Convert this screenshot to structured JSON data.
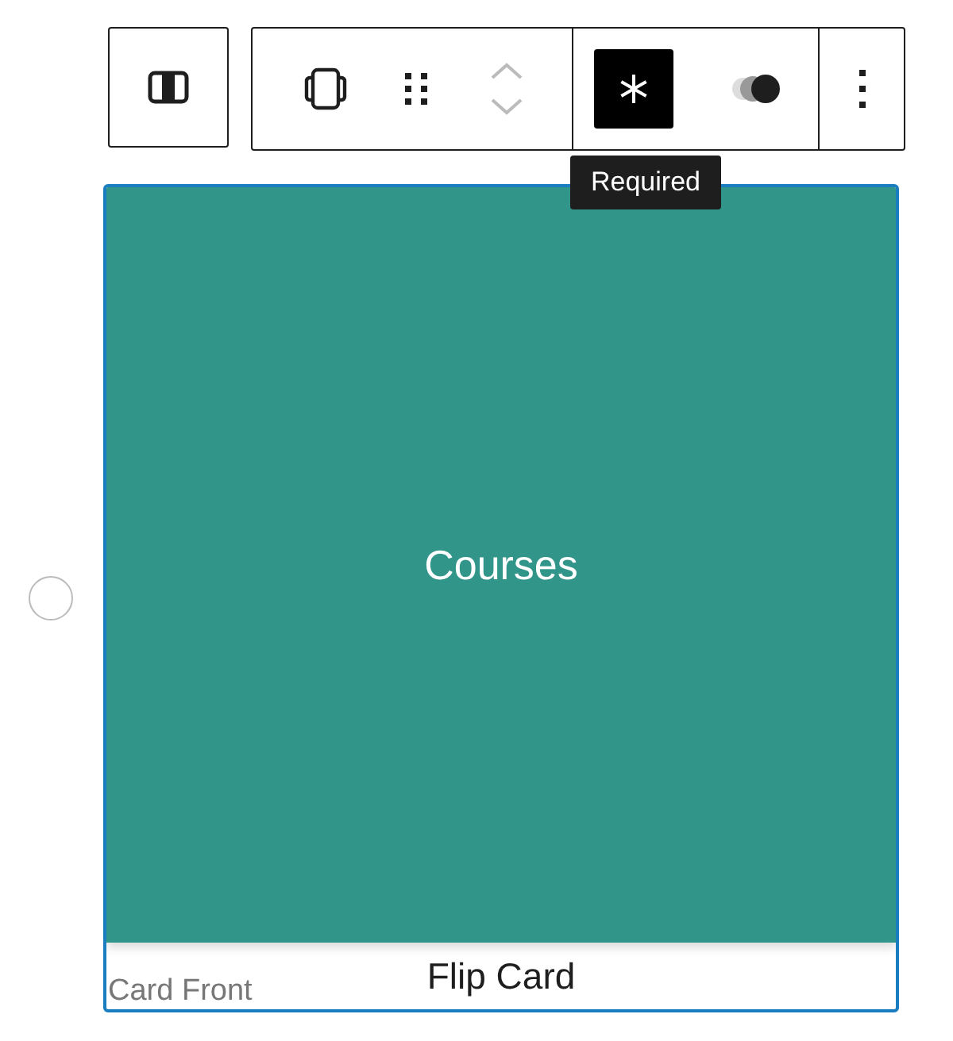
{
  "block_switcher": {
    "kind": "columns",
    "selected": false,
    "disabled": false
  },
  "toolbar_groups": [
    [
      {
        "kind": "card",
        "selected": false,
        "disabled": false
      },
      {
        "kind": "drag",
        "selected": false,
        "disabled": false
      },
      {
        "kind": "mover",
        "selected": false,
        "disabled": true
      }
    ],
    [
      {
        "kind": "required",
        "selected": true,
        "disabled": false
      },
      {
        "kind": "toggle",
        "selected": false,
        "disabled": false
      }
    ],
    [
      {
        "kind": "more",
        "selected": false,
        "disabled": false
      }
    ]
  ],
  "tooltip": "Required",
  "radio": {
    "selected": false
  },
  "card": {
    "text": "Courses",
    "color": "#31958a",
    "label": "Card Front",
    "title": "Flip Card"
  }
}
